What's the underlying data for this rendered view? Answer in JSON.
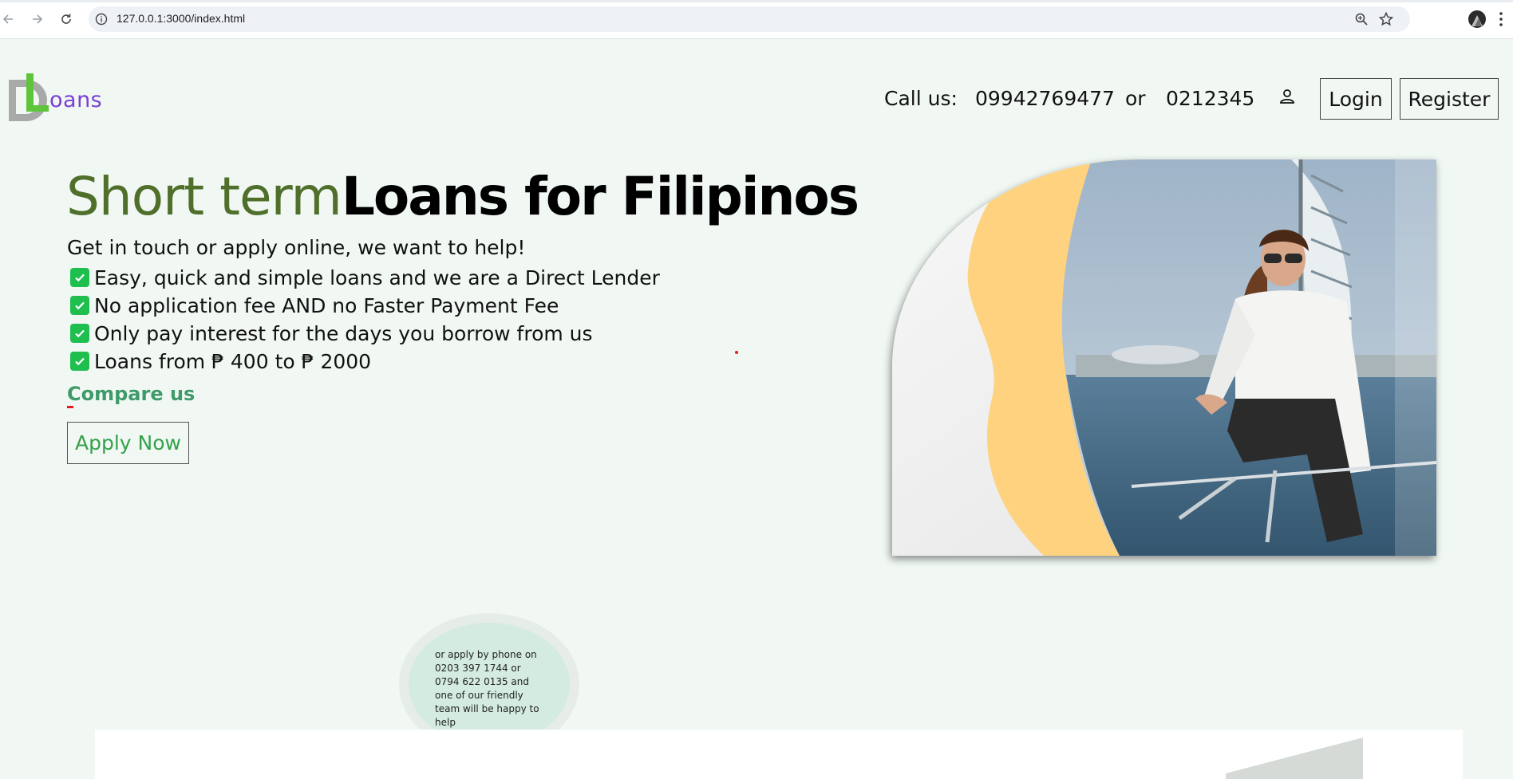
{
  "browser": {
    "url": "127.0.0.1:3000/index.html"
  },
  "header": {
    "logo_text": "oans",
    "call_label": "Call us:",
    "phone_primary": "09942769477",
    "or_text": "or",
    "phone_secondary": "0212345",
    "login_label": "Login",
    "register_label": "Register"
  },
  "hero": {
    "title_light": "Short term",
    "title_bold": "Loans for Filipinos",
    "lead": "Get in touch or apply online, we want to help!",
    "features": [
      "Easy, quick and simple loans and we are a Direct Lender",
      "No application fee AND no Faster Payment Fee",
      "Only pay interest for the days you borrow from us",
      "Loans from ₱ 400 to ₱ 2000"
    ],
    "compare_label": "Compare us",
    "apply_label": "Apply Now"
  },
  "phone_bubble": {
    "text": "or apply by phone on 0203 397 1744 or 0794 622 0135 and one of our friendly team will be happy to help"
  },
  "colors": {
    "page_bg": "#f1f8f3",
    "title_light": "#4f6f2a",
    "logo_purple": "#7a3fd6",
    "logo_green": "#5ec43a",
    "check_green": "#1fbf4f",
    "compare_green": "#3f9a6a",
    "apply_green": "#34a04a",
    "image_yellow": "#ffd27f"
  },
  "icons": {
    "back": "arrow-left-icon",
    "forward": "arrow-right-icon",
    "reload": "reload-icon",
    "info": "info-icon",
    "zoom": "zoom-icon",
    "bookmark": "star-icon",
    "profile": "profile-avatar",
    "menu": "kebab-menu-icon",
    "user": "user-icon",
    "check": "checkbox-check-icon"
  }
}
